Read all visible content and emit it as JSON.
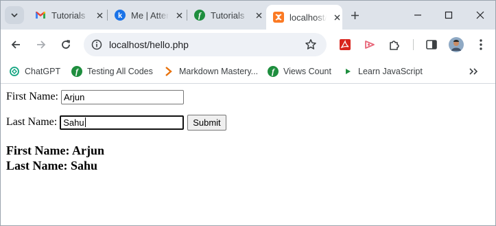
{
  "tabs": [
    {
      "title": "Tutorials",
      "favicon": "gmail-icon"
    },
    {
      "title": "Me | Attendance",
      "favicon": "k-icon"
    },
    {
      "title": "Tutorials",
      "favicon": "f-leaf-icon"
    },
    {
      "title": "localhost/hello.php",
      "favicon": "xampp-icon",
      "active": true
    }
  ],
  "toolbar": {
    "url": "localhost/hello.php"
  },
  "bookmarks": [
    {
      "label": "ChatGPT",
      "icon": "chatgpt-icon"
    },
    {
      "label": "Testing All Codes",
      "icon": "f-leaf-icon"
    },
    {
      "label": "Markdown Mastery...",
      "icon": "chevron-bookmark-icon"
    },
    {
      "label": "Views Count",
      "icon": "f-leaf-icon"
    },
    {
      "label": "Learn JavaScript",
      "icon": "play-icon"
    }
  ],
  "form": {
    "first_label": "First Name:",
    "first_value": "Arjun",
    "last_label": "Last Name:",
    "last_value": "Sahu",
    "submit_label": "Submit"
  },
  "output": {
    "first_line": "First Name: Arjun",
    "last_line": "Last Name: Sahu"
  },
  "colors": {
    "tabstrip": "#dee3ea",
    "omnibox": "#eef1f6",
    "accent_green": "#1e8e3e"
  }
}
